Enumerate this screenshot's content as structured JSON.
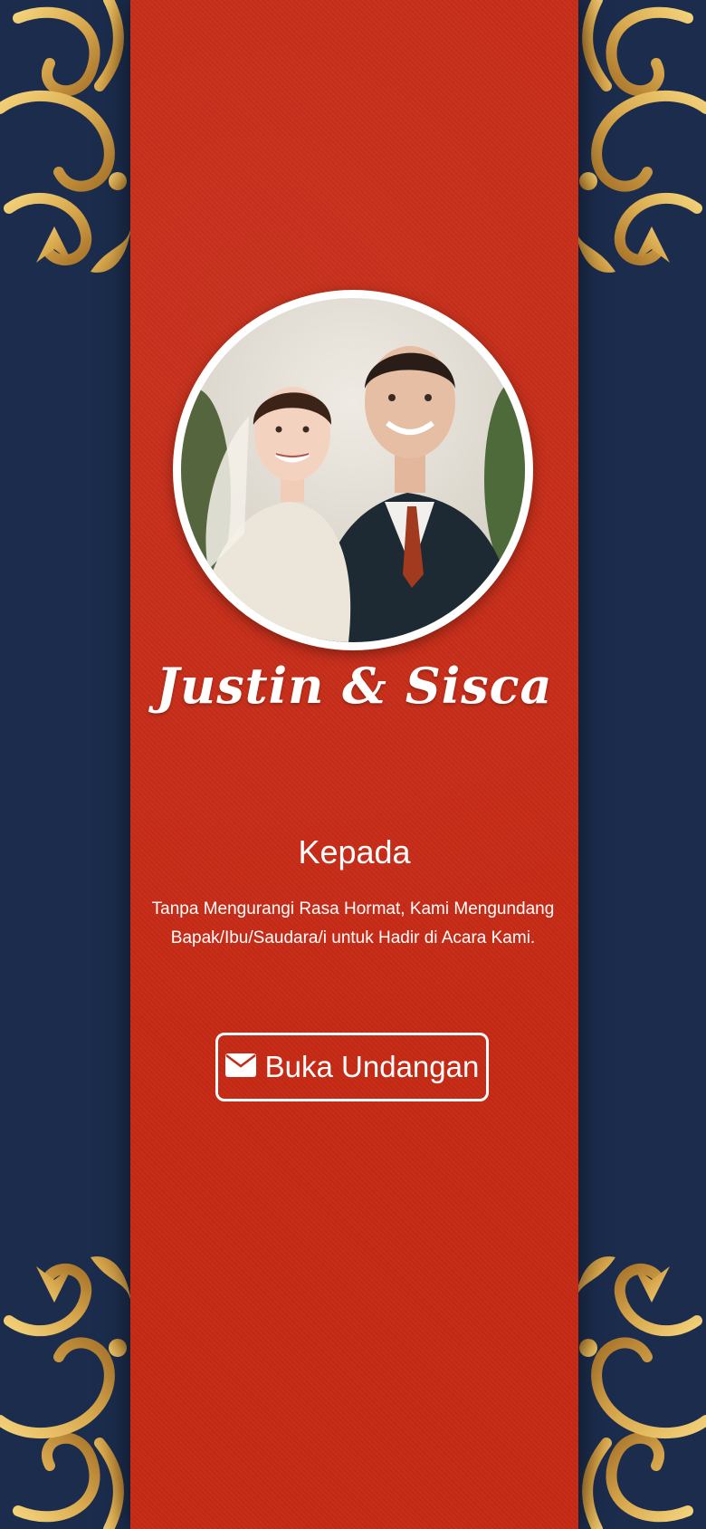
{
  "invitation": {
    "couple_names": "Justin & Sisca",
    "greeting": "Kepada",
    "message": "Tanpa Mengurangi Rasa Hormat, Kami Mengundang Bapak/Ibu/Saudara/i untuk Hadir di Acara Kami.",
    "open_button_label": "Buka Undangan",
    "open_button_icon": "envelope-icon"
  },
  "colors": {
    "background_navy": "#1b2c4c",
    "panel_red": "#c62a15",
    "ornament_gold": "#d9a94e",
    "text_white": "#ffffff"
  }
}
